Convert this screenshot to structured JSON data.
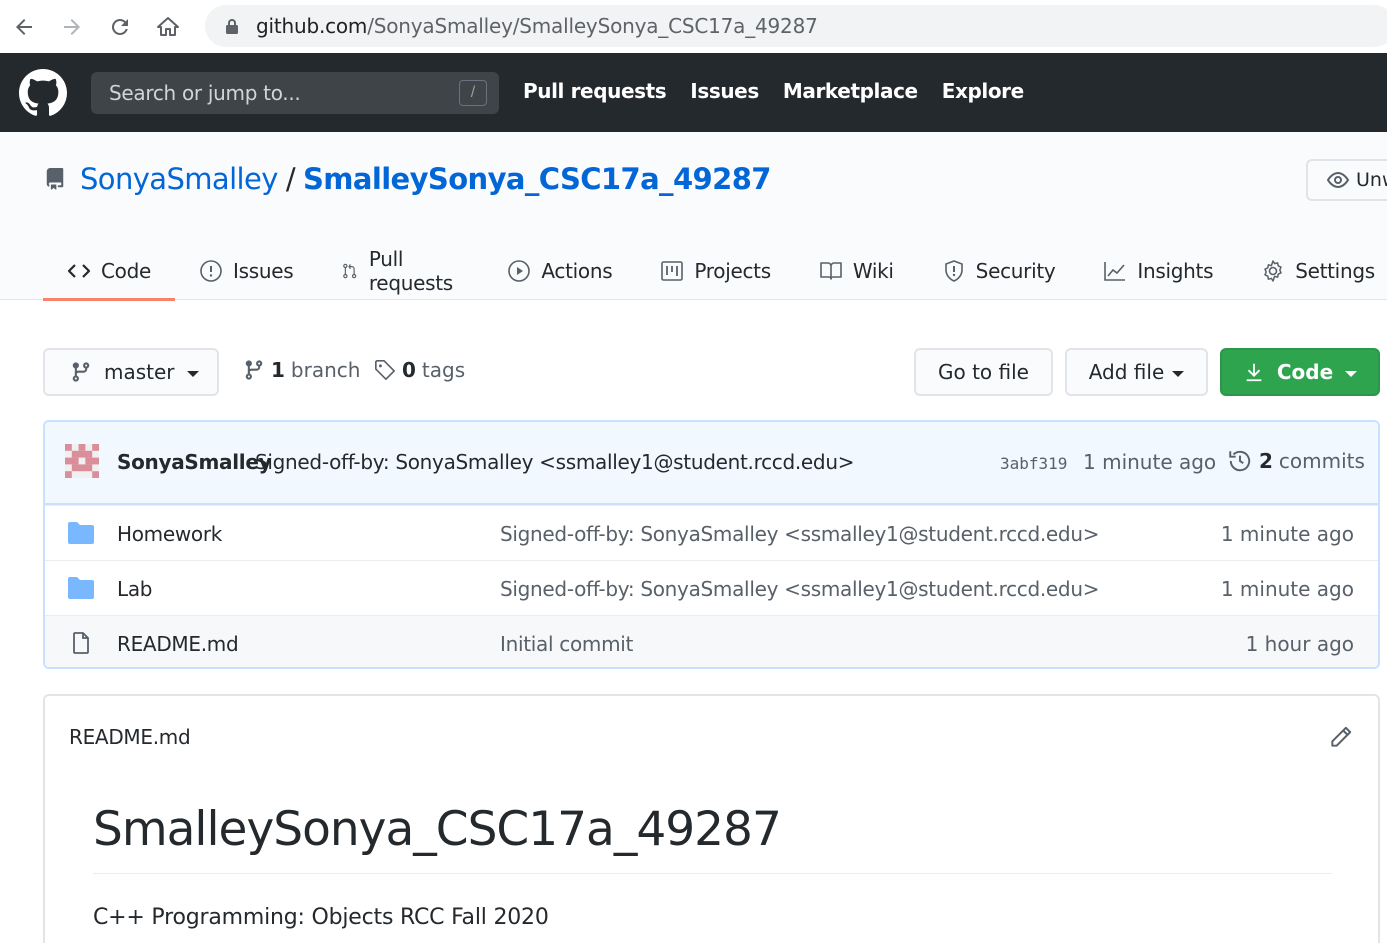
{
  "browser": {
    "url_host": "github.com",
    "url_path": "/SonyaSmalley/SmalleySonya_CSC17a_49287"
  },
  "header": {
    "search_placeholder": "Search or jump to...",
    "search_shortcut": "/",
    "nav": [
      "Pull requests",
      "Issues",
      "Marketplace",
      "Explore"
    ]
  },
  "repo": {
    "owner": "SonyaSmalley",
    "separator": "/",
    "name": "SmalleySonya_CSC17a_49287",
    "watch_label": "Unw"
  },
  "tabs": [
    {
      "label": "Code",
      "icon": "code-icon",
      "active": true
    },
    {
      "label": "Issues",
      "icon": "issue-icon"
    },
    {
      "label": "Pull requests",
      "icon": "pull-request-icon"
    },
    {
      "label": "Actions",
      "icon": "play-icon"
    },
    {
      "label": "Projects",
      "icon": "project-icon"
    },
    {
      "label": "Wiki",
      "icon": "book-icon"
    },
    {
      "label": "Security",
      "icon": "shield-icon"
    },
    {
      "label": "Insights",
      "icon": "graph-icon"
    },
    {
      "label": "Settings",
      "icon": "gear-icon"
    }
  ],
  "filenav": {
    "branch": "master",
    "branch_count": "1",
    "branch_word": "branch",
    "tag_count": "0",
    "tag_word": "tags",
    "goto_file": "Go to file",
    "add_file": "Add file",
    "code": "Code"
  },
  "commit": {
    "author": "SonyaSmalley",
    "message": "Signed-off-by: SonyaSmalley <ssmalley1@student.rccd.edu>",
    "sha": "3abf319",
    "time": "1 minute ago",
    "commit_count": "2",
    "commit_word": "commits"
  },
  "files": [
    {
      "type": "folder",
      "name": "Homework",
      "message": "Signed-off-by: SonyaSmalley <ssmalley1@student.rccd.edu>",
      "time": "1 minute ago"
    },
    {
      "type": "folder",
      "name": "Lab",
      "message": "Signed-off-by: SonyaSmalley <ssmalley1@student.rccd.edu>",
      "time": "1 minute ago"
    },
    {
      "type": "file",
      "name": "README.md",
      "message": "Initial commit",
      "time": "1 hour ago"
    }
  ],
  "readme": {
    "filename": "README.md",
    "heading": "SmalleySonya_CSC17a_49287",
    "paragraph": "C++ Programming: Objects RCC Fall 2020"
  },
  "colors": {
    "header_bg": "#24292e",
    "link": "#0366d6",
    "tab_underline": "#f9826c",
    "code_button": "#2ea44f",
    "folder": "#79b8ff"
  }
}
